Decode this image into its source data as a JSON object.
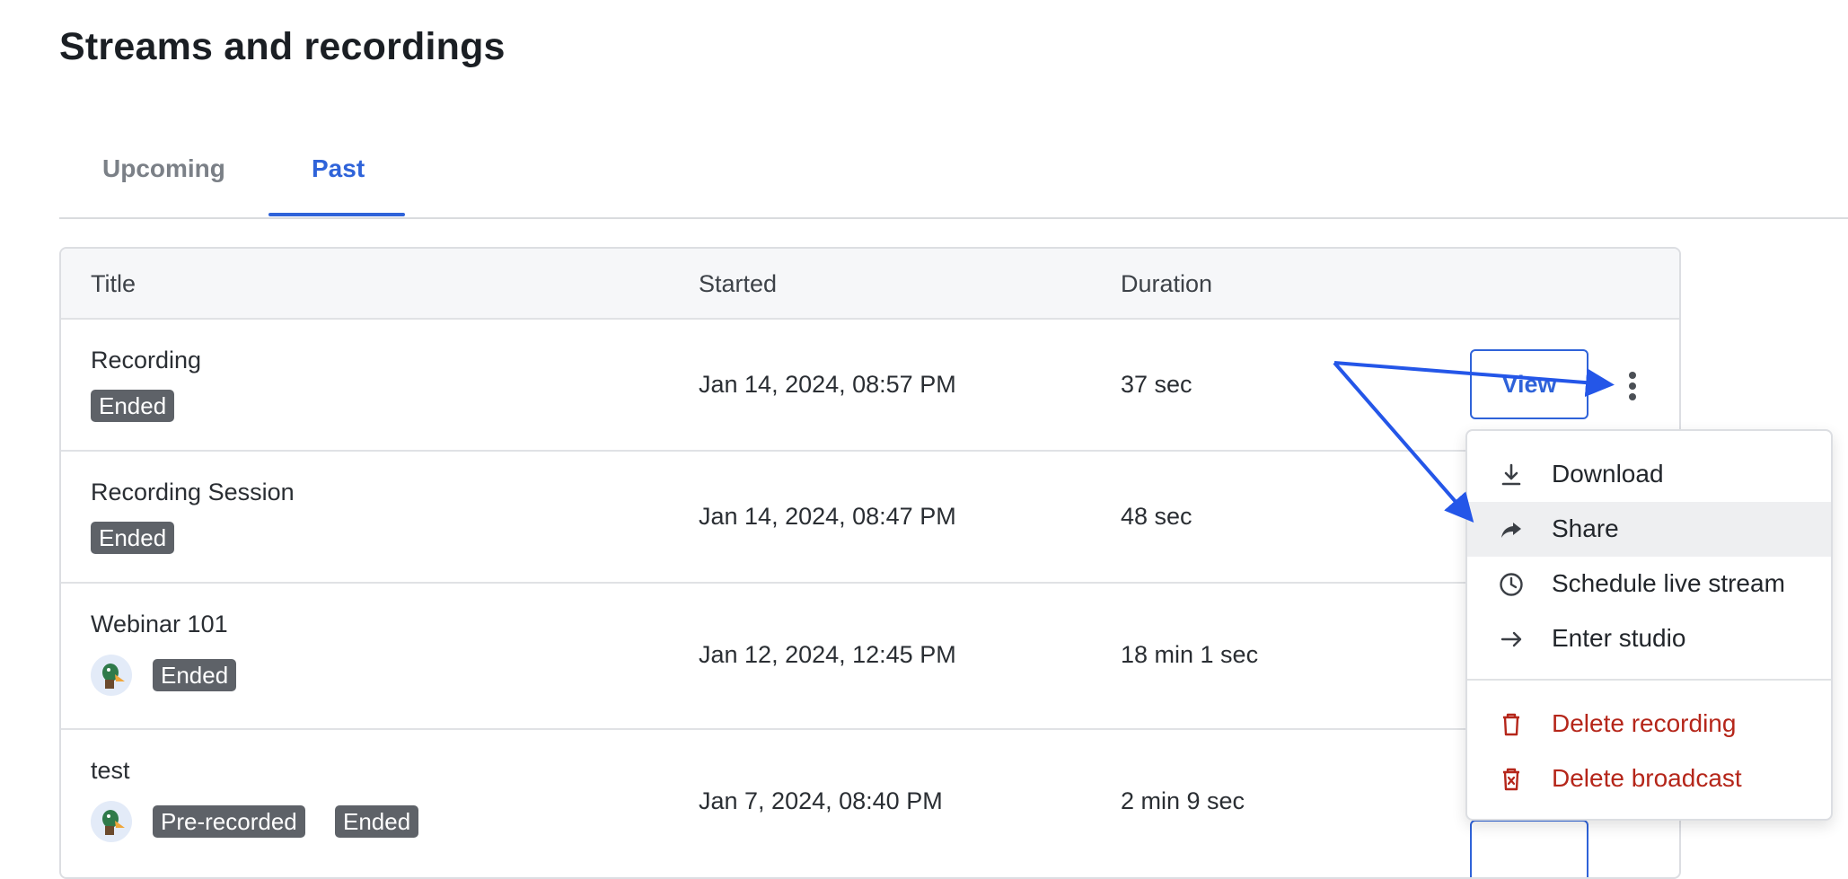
{
  "page": {
    "title": "Streams and recordings"
  },
  "tabs": [
    {
      "label": "Upcoming",
      "active": false
    },
    {
      "label": "Past",
      "active": true
    }
  ],
  "colors": {
    "accent": "#2f63d9",
    "danger": "#b5261a",
    "badge": "#5e6268",
    "hover": "#eeeff1"
  },
  "table": {
    "headers": [
      "Title",
      "Started",
      "Duration"
    ],
    "rows": [
      {
        "title": "Recording",
        "badges": [
          "Ended"
        ],
        "avatar": false,
        "started": "Jan 14, 2024, 08:57 PM",
        "duration": "37 sec",
        "action": "View"
      },
      {
        "title": "Recording Session",
        "badges": [
          "Ended"
        ],
        "avatar": false,
        "started": "Jan 14, 2024, 08:47 PM",
        "duration": "48 sec"
      },
      {
        "title": "Webinar 101",
        "badges": [
          "Ended"
        ],
        "avatar": true,
        "started": "Jan 12, 2024, 12:45 PM",
        "duration": "18 min 1 sec"
      },
      {
        "title": "test",
        "badges": [
          "Pre-recorded",
          "Ended"
        ],
        "avatar": true,
        "started": "Jan 7, 2024, 08:40 PM",
        "duration": "2 min 9 sec"
      }
    ]
  },
  "menu": {
    "items": [
      {
        "label": "Download",
        "icon": "download-icon"
      },
      {
        "label": "Share",
        "icon": "share-icon"
      },
      {
        "label": "Schedule live stream",
        "icon": "clock-icon"
      },
      {
        "label": "Enter studio",
        "icon": "arrow-right-icon"
      }
    ],
    "danger_items": [
      {
        "label": "Delete recording",
        "icon": "trash-icon"
      },
      {
        "label": "Delete broadcast",
        "icon": "delete-broadcast-icon"
      }
    ]
  }
}
